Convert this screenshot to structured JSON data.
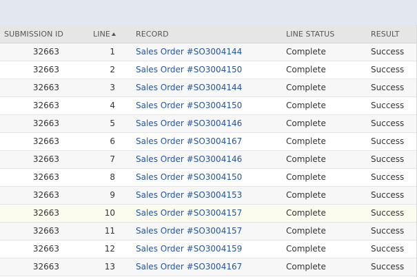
{
  "table": {
    "columns": {
      "submission_id": "SUBMISSION ID",
      "line": "LINE",
      "record": "RECORD",
      "line_status": "LINE STATUS",
      "result": "RESULT"
    },
    "sort": {
      "column": "line",
      "direction": "ascending",
      "icon": "sort-ascending-icon"
    },
    "highlighted_row": 10,
    "rows": [
      {
        "submission_id": "32663",
        "line": "1",
        "record": "Sales Order #SO3004144",
        "line_status": "Complete",
        "result": "Success"
      },
      {
        "submission_id": "32663",
        "line": "2",
        "record": "Sales Order #SO3004150",
        "line_status": "Complete",
        "result": "Success"
      },
      {
        "submission_id": "32663",
        "line": "3",
        "record": "Sales Order #SO3004144",
        "line_status": "Complete",
        "result": "Success"
      },
      {
        "submission_id": "32663",
        "line": "4",
        "record": "Sales Order #SO3004150",
        "line_status": "Complete",
        "result": "Success"
      },
      {
        "submission_id": "32663",
        "line": "5",
        "record": "Sales Order #SO3004146",
        "line_status": "Complete",
        "result": "Success"
      },
      {
        "submission_id": "32663",
        "line": "6",
        "record": "Sales Order #SO3004167",
        "line_status": "Complete",
        "result": "Success"
      },
      {
        "submission_id": "32663",
        "line": "7",
        "record": "Sales Order #SO3004146",
        "line_status": "Complete",
        "result": "Success"
      },
      {
        "submission_id": "32663",
        "line": "8",
        "record": "Sales Order #SO3004150",
        "line_status": "Complete",
        "result": "Success"
      },
      {
        "submission_id": "32663",
        "line": "9",
        "record": "Sales Order #SO3004153",
        "line_status": "Complete",
        "result": "Success"
      },
      {
        "submission_id": "32663",
        "line": "10",
        "record": "Sales Order #SO3004157",
        "line_status": "Complete",
        "result": "Success"
      },
      {
        "submission_id": "32663",
        "line": "11",
        "record": "Sales Order #SO3004157",
        "line_status": "Complete",
        "result": "Success"
      },
      {
        "submission_id": "32663",
        "line": "12",
        "record": "Sales Order #SO3004159",
        "line_status": "Complete",
        "result": "Success"
      },
      {
        "submission_id": "32663",
        "line": "13",
        "record": "Sales Order #SO3004167",
        "line_status": "Complete",
        "result": "Success"
      }
    ]
  },
  "colors": {
    "link": "#255599",
    "header_bg": "#e6e6e6",
    "top_band": "#e3e8f0",
    "row_alt": "#f7f7f7",
    "row_highlight": "#fbfcee"
  }
}
